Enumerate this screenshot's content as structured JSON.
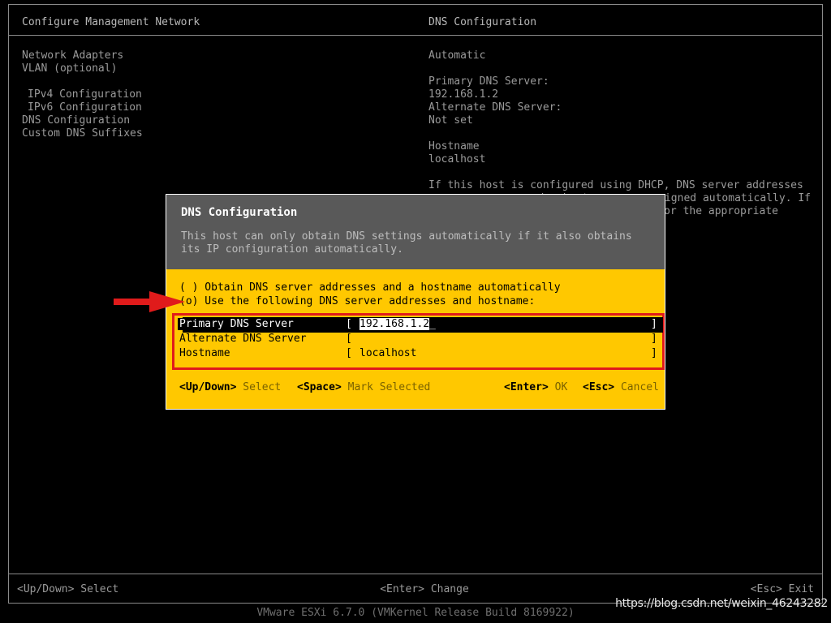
{
  "screen": {
    "left_panel": {
      "title": "Configure Management Network",
      "items": [
        "Network Adapters",
        "VLAN (optional)",
        "",
        "IPv4 Configuration",
        "IPv6 Configuration",
        "DNS Configuration",
        "Custom DNS Suffixes"
      ]
    },
    "right_panel": {
      "title": "DNS Configuration",
      "lines": [
        "Automatic",
        "",
        "Primary DNS Server:",
        "192.168.1.2",
        "Alternate DNS Server:",
        "Not set",
        "",
        "Hostname",
        "localhost",
        "",
        "If this host is configured using DHCP, DNS server addresses",
        "and a hostname are assigned automatically. If",
        "or the appropriate"
      ]
    },
    "bottom_bar": {
      "left_key": "<Up/Down>",
      "left_label": " Select",
      "mid_key": "<Enter>",
      "mid_label": " Change",
      "right_key": "<Esc>",
      "right_label": " Exit"
    },
    "version": "VMware ESXi 6.7.0 (VMKernel Release Build 8169922)",
    "watermark": "https://blog.csdn.net/weixin_46243282"
  },
  "dialog": {
    "title": "DNS Configuration",
    "description": "This host can only obtain DNS settings automatically if it also obtains\nits IP configuration automatically.",
    "options": [
      {
        "marker": "( )",
        "label": " Obtain DNS server addresses and a hostname automatically",
        "selected": false
      },
      {
        "marker": "(o)",
        "label": " Use the following DNS server addresses and hostname:",
        "selected": true
      }
    ],
    "fields": [
      {
        "label": "Primary DNS Server",
        "value": "192.168.1.2",
        "selected": true,
        "cursor": "_"
      },
      {
        "label": "Alternate DNS Server",
        "value": "",
        "selected": false,
        "cursor": ""
      },
      {
        "label": "Hostname",
        "value": "localhost",
        "selected": false,
        "cursor": ""
      }
    ],
    "bracket_open": "[",
    "bracket_close": "]",
    "footer": [
      {
        "key": "<Up/Down>",
        "label": " Select"
      },
      {
        "key": "<Space>",
        "label": " Mark Selected"
      },
      {
        "key": "<Enter>",
        "label": " OK"
      },
      {
        "key": "<Esc>",
        "label": " Cancel"
      }
    ]
  },
  "annotation": {
    "arrow_color": "#e01b1b",
    "highlight_box_color": "#e01b1b"
  },
  "colors": {
    "background": "#000000",
    "dialog_header": "#595959",
    "dialog_body": "#ffc800",
    "text_dim": "#9a9a9a",
    "text_bright": "#ffffff"
  }
}
